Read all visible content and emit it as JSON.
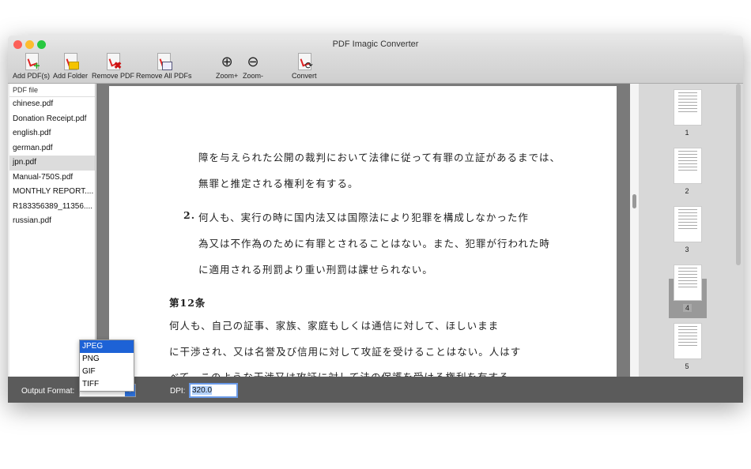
{
  "window": {
    "title": "PDF Imagic Converter"
  },
  "toolbar": {
    "add_pdfs": "Add PDF(s)",
    "add_folder": "Add Folder",
    "remove_pdf": "Remove PDF",
    "remove_all": "Remove All PDFs",
    "zoom_in": "Zoom+",
    "zoom_out": "Zoom-",
    "convert": "Convert"
  },
  "sidebar": {
    "header": "PDF file",
    "items": [
      "chinese.pdf",
      "Donation Receipt.pdf",
      "english.pdf",
      "german.pdf",
      "jpn.pdf",
      "Manual-750S.pdf",
      "MONTHLY REPORT....",
      "R183356389_11356....",
      "russian.pdf"
    ],
    "selected": "jpn.pdf"
  },
  "document": {
    "lines": [
      "障を与えられた公開の裁判において法律に従って有罪の立証があるまでは、",
      "無罪と推定される権利を有する。",
      "何人も、実行の時に国内法又は国際法により犯罪を構成しなかった作",
      "為又は不作為のために有罪とされることはない。また、犯罪が行われた時",
      "に適用される刑罰より重い刑罰は課せられない。",
      "何人も、自己の証事、家族、家庭もしくは通信に対して、ほしいまま",
      "に干渉され、又は名誉及び信用に対して攻証を受けることはない。人はす",
      "べて、このような干渉又は攻証に対して法の保護を受ける権利を有する。"
    ],
    "item_number": "2.",
    "heading": "第12条"
  },
  "thumbnails": {
    "pages": [
      "1",
      "2",
      "3",
      "4",
      "5"
    ],
    "selected": "4"
  },
  "bottom": {
    "output_format_label": "Output Format:",
    "format_value": "JPEG",
    "format_options": [
      "JPEG",
      "PNG",
      "GIF",
      "TIFF"
    ],
    "dpi_label": "DPI:",
    "dpi_value": "320.0"
  },
  "colors": {
    "accent": "#1d62d6",
    "bottom_bar": "#5b5b5b"
  }
}
